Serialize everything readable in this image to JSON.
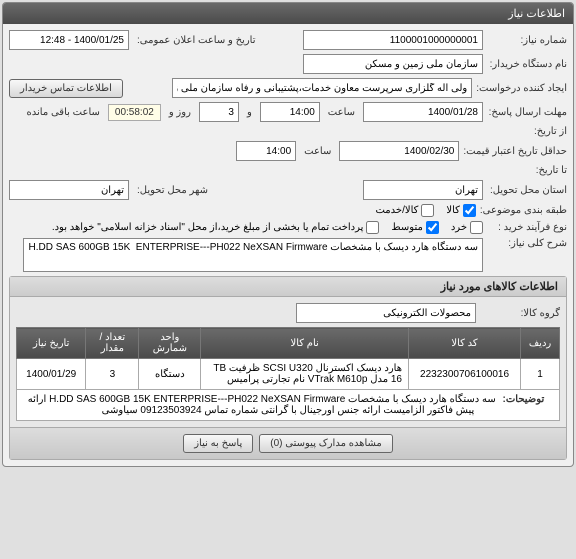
{
  "panels": {
    "main_header": "اطلاعات نیاز",
    "items_header": "اطلاعات کالاهای مورد نیاز"
  },
  "labels": {
    "need_no": "شماره نیاز:",
    "announce_datetime": "تاریخ و ساعت اعلان عمومی:",
    "buyer_org": "نام دستگاه خریدار:",
    "creator": "ایجاد کننده درخواست:",
    "buyer_contact": "اطلاعات تماس خریدار",
    "answer_deadline": "مهلت ارسال پاسخ:",
    "hour": "ساعت",
    "and": "و",
    "day": "روز و",
    "remaining": "ساعت باقی مانده",
    "from_date": "از تاریخ:",
    "price_validity": "حداقل تاریخ اعتبار قیمت:",
    "to_date": "تا تاریخ:",
    "delivery_state": "استان محل تحویل:",
    "delivery_city": "شهر محل تحویل:",
    "budget_type": "طبقه بندی موضوعی:",
    "goods": "کالا",
    "service": "کالا/خدمت",
    "purchase_type": "نوع فرآیند خرید :",
    "small": "خرد",
    "medium": "متوسط",
    "partial_note": "پرداخت تمام یا بخشی از مبلغ خرید،از محل \"اسناد خزانه اسلامی\" خواهد بود.",
    "need_title": "شرح کلی نیاز:",
    "item_group": "گروه کالا:",
    "description": "توضیحات:",
    "view_attachments": "مشاهده مدارک پیوستی (0)",
    "answer_need": "پاسخ به نیاز"
  },
  "values": {
    "need_no": "1100001000000001",
    "announce_datetime": "1400/01/25 - 12:48",
    "buyer_org": "سازمان ملی زمین و مسکن",
    "creator": "ولی اله گلزاری سرپرست معاون خدمات،پشتیبانی و رفاه سازمان ملی زمین و م",
    "answer_date": "1400/01/28",
    "answer_time": "14:00",
    "days_left": "3",
    "time_left": "00:58:02",
    "validity_date": "1400/02/30",
    "validity_time": "14:00",
    "delivery_state": "تهران",
    "delivery_city": "تهران",
    "need_title": "سه دستگاه هارد دیسک با مشخصات H.DD SAS 600GB 15K  ENTERPRISE---PH022 NeXSAN Firmware",
    "item_group": "محصولات الکترونیکی"
  },
  "table": {
    "headers": [
      "ردیف",
      "کد کالا",
      "نام کالا",
      "واحد شمارش",
      "تعداد / مقدار",
      "تاریخ نیاز"
    ],
    "row": {
      "idx": "1",
      "code": "2232300706100016",
      "name": "هارد دیسک اکسترنال SCSI U320 ظرفیت TB 16 مدل VTrak M610p نام تجارتی پرامیس",
      "unit": "دستگاه",
      "qty": "3",
      "date": "1400/01/29"
    },
    "description": "سه دستگاه هارد دیسک با مشخصات H.DD SAS 600GB 15K  ENTERPRISE---PH022 NeXSAN Firmware ارائه پیش فاکتور الزامیست ارائه جنس اورجینال  با گرانتی  شماره تماس 09123503924 سیاوشی"
  }
}
